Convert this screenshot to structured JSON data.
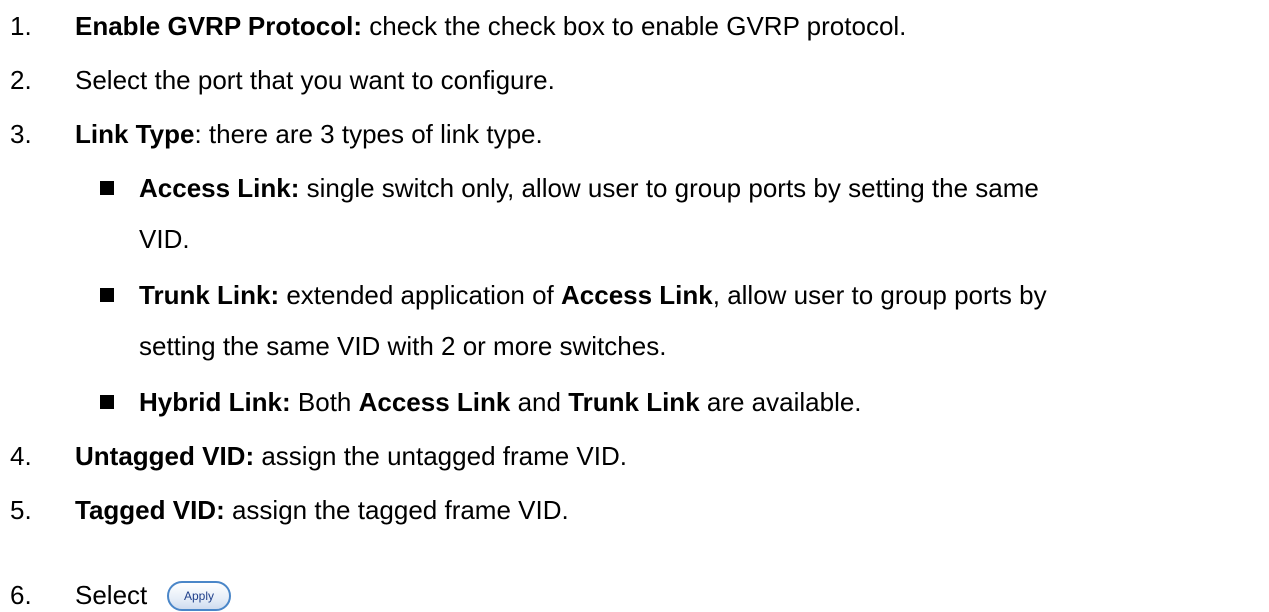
{
  "items": {
    "i1": {
      "num": "1.",
      "bold": "Enable GVRP Protocol:",
      "text": " check the check box to enable GVRP protocol."
    },
    "i2": {
      "num": "2.",
      "text": "Select the port that you want to configure."
    },
    "i3": {
      "num": "3.",
      "bold": "Link Type",
      "text": ": there are 3 types of link type."
    },
    "i4": {
      "num": "4.",
      "bold": "Untagged VID:",
      "text": " assign the untagged frame VID."
    },
    "i5": {
      "num": "5.",
      "bold": "Tagged VID:",
      "text": " assign the tagged frame VID."
    },
    "i6": {
      "num": "6.",
      "text": "Select"
    }
  },
  "link_types": {
    "access": {
      "bold": "Access Link:",
      "text_line1": " single switch only, allow user to group ports by setting the same",
      "text_line2": "VID."
    },
    "trunk": {
      "bold": "Trunk Link:",
      "text1": " extended application of ",
      "bold2": "Access Link",
      "text2": ", allow user to group ports by",
      "text_line2": "setting the same VID with 2 or more switches."
    },
    "hybrid": {
      "bold": "Hybrid Link:",
      "text1": " Both ",
      "bold2": "Access Link",
      "text2": " and ",
      "bold3": "Trunk Link",
      "text3": " are available."
    }
  },
  "apply_button": {
    "label": "Apply"
  }
}
